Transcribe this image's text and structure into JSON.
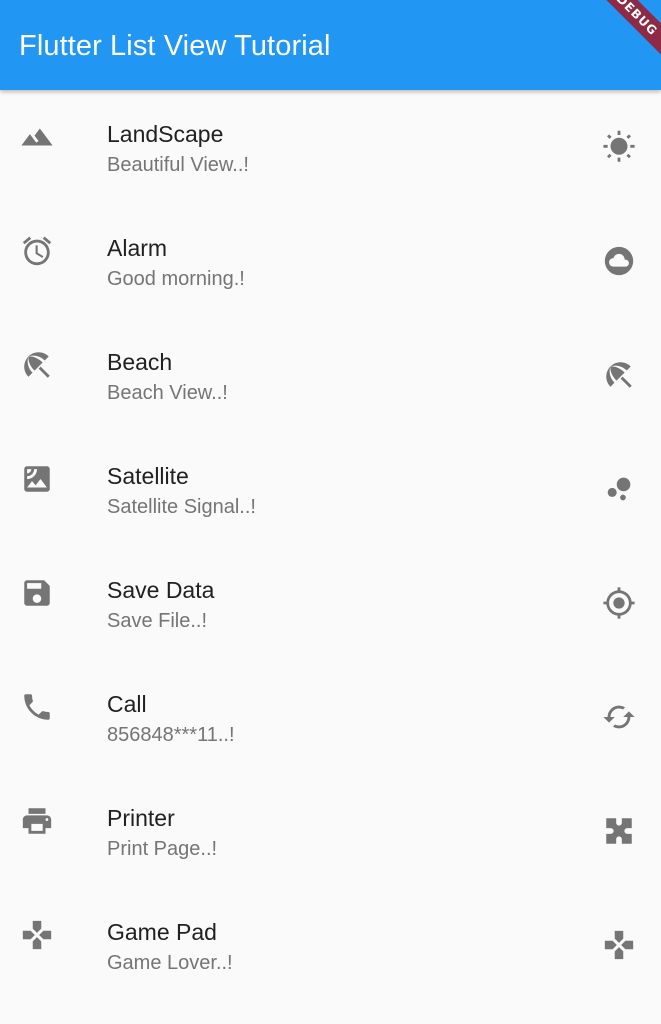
{
  "appbar": {
    "title": "Flutter List View Tutorial",
    "color": "#2196f3"
  },
  "debug_banner": "DEBUG",
  "items": [
    {
      "title": "LandScape",
      "subtitle": "Beautiful View..!",
      "leading_icon": "landscape-icon",
      "trailing_icon": "sun-icon"
    },
    {
      "title": "Alarm",
      "subtitle": "Good morning.!",
      "leading_icon": "alarm-icon",
      "trailing_icon": "cloud-icon"
    },
    {
      "title": "Beach",
      "subtitle": "Beach View..!",
      "leading_icon": "beach-umbrella-icon",
      "trailing_icon": "beach-umbrella-icon"
    },
    {
      "title": "Satellite",
      "subtitle": "Satellite Signal..!",
      "leading_icon": "satellite-icon",
      "trailing_icon": "bubbles-icon"
    },
    {
      "title": "Save Data",
      "subtitle": "Save File..!",
      "leading_icon": "save-icon",
      "trailing_icon": "gps-fixed-icon"
    },
    {
      "title": "Call",
      "subtitle": "856848***11..!",
      "leading_icon": "phone-icon",
      "trailing_icon": "sync-icon"
    },
    {
      "title": "Printer",
      "subtitle": "Print Page..!",
      "leading_icon": "printer-icon",
      "trailing_icon": "extension-icon"
    },
    {
      "title": "Game Pad",
      "subtitle": "Game Lover..!",
      "leading_icon": "gamepad-icon",
      "trailing_icon": "gamepad-icon"
    }
  ]
}
